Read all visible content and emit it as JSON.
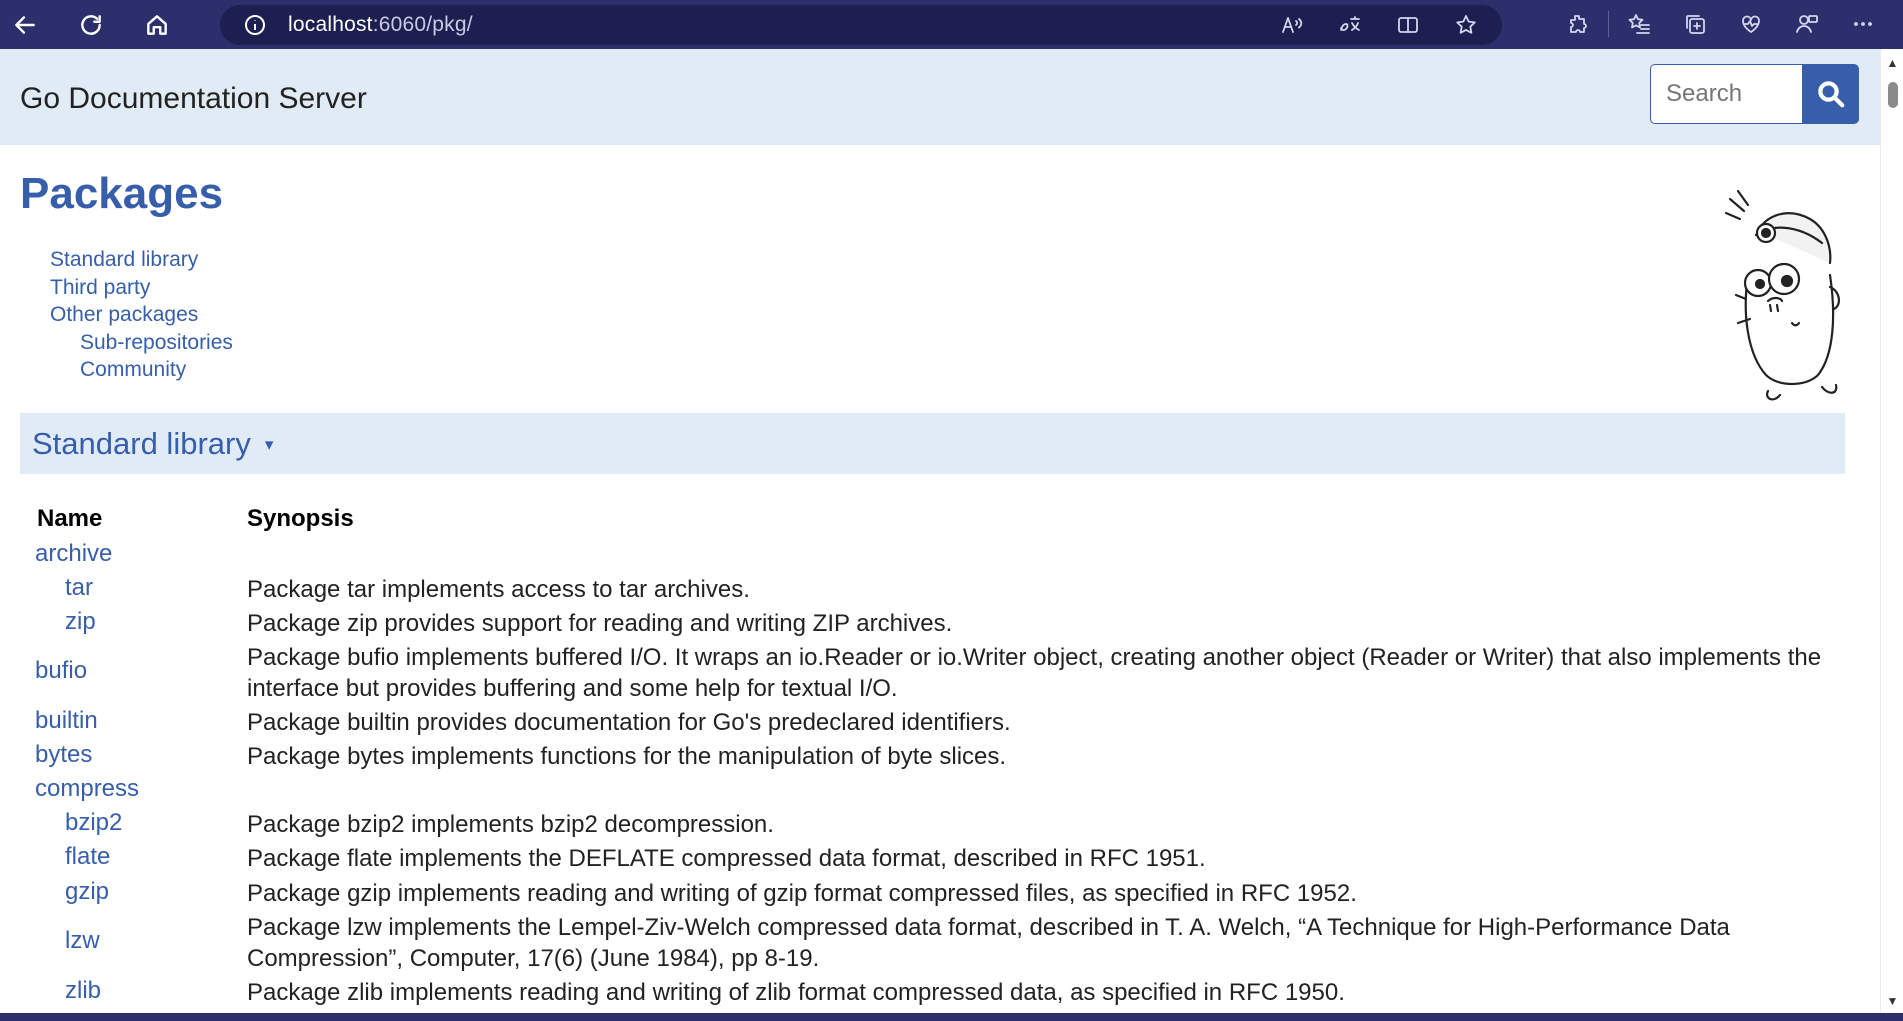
{
  "browser": {
    "url_host": "localhost",
    "url_rest": ":6060/pkg/",
    "icons": [
      "back-icon",
      "refresh-icon",
      "home-icon",
      "info-icon",
      "read-aloud-icon",
      "translate-icon",
      "split-screen-icon",
      "favorite-star-icon",
      "extensions-icon",
      "favorites-icon",
      "collections-icon",
      "browser-essentials-icon",
      "profile-icon",
      "more-icon"
    ]
  },
  "header": {
    "title": "Go Documentation Server",
    "search_placeholder": "Search"
  },
  "page": {
    "title": "Packages",
    "toc": [
      {
        "label": "Standard library"
      },
      {
        "label": "Third party"
      },
      {
        "label": "Other packages"
      },
      {
        "label": "Sub-repositories"
      },
      {
        "label": "Community"
      }
    ]
  },
  "section": {
    "title": "Standard library",
    "arrow": "▾"
  },
  "table": {
    "col_name": "Name",
    "col_synopsis": "Synopsis",
    "rows": [
      {
        "name": "archive",
        "synopsis": ""
      },
      {
        "name": "tar",
        "synopsis": "Package tar implements access to tar archives."
      },
      {
        "name": "zip",
        "synopsis": "Package zip provides support for reading and writing ZIP archives."
      },
      {
        "name": "bufio",
        "synopsis": "Package bufio implements buffered I/O. It wraps an io.Reader or io.Writer object, creating another object (Reader or Writer) that also implements the interface but provides buffering and some help for textual I/O."
      },
      {
        "name": "builtin",
        "synopsis": "Package builtin provides documentation for Go's predeclared identifiers."
      },
      {
        "name": "bytes",
        "synopsis": "Package bytes implements functions for the manipulation of byte slices."
      },
      {
        "name": "compress",
        "synopsis": ""
      },
      {
        "name": "bzip2",
        "synopsis": "Package bzip2 implements bzip2 decompression."
      },
      {
        "name": "flate",
        "synopsis": "Package flate implements the DEFLATE compressed data format, described in RFC 1951."
      },
      {
        "name": "gzip",
        "synopsis": "Package gzip implements reading and writing of gzip format compressed files, as specified in RFC 1952."
      },
      {
        "name": "lzw",
        "synopsis": "Package lzw implements the Lempel-Ziv-Welch compressed data format, described in T. A. Welch, “A Technique for High-Performance Data Compression”, Computer, 17(6) (June 1984), pp 8-19."
      },
      {
        "name": "zlib",
        "synopsis": "Package zlib implements reading and writing of zlib format compressed data, as specified in RFC 1950."
      }
    ]
  },
  "colors": {
    "link": "#375eab",
    "header_bg": "#e0ebf5",
    "browser_bg": "#2c2f6b"
  }
}
